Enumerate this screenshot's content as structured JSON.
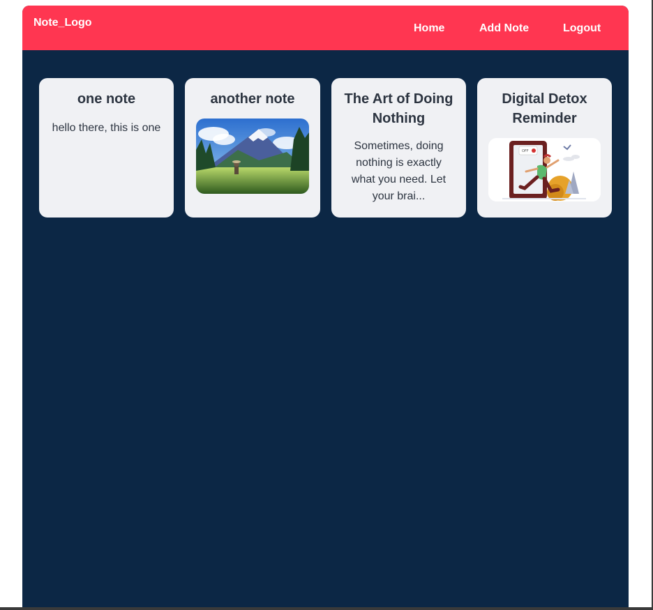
{
  "navbar": {
    "logo": "Note_Logo",
    "links": [
      "Home",
      "Add Note",
      "Logout"
    ]
  },
  "notes": [
    {
      "title": "one note",
      "body": "hello there, this is one"
    },
    {
      "title": "another note",
      "image": "mountain-landscape-image"
    },
    {
      "title": "The Art of Doing Nothing",
      "body": "Sometimes, doing nothing is exactly what you need. Let your brai..."
    },
    {
      "title": "Digital Detox Reminder",
      "image": "digital-detox-illustration",
      "image_text": "OFF"
    }
  ],
  "colors": {
    "navbar": "#ff3651",
    "page_background": "#0c2745",
    "card": "#f0f1f4",
    "card_text": "#2c3440"
  }
}
